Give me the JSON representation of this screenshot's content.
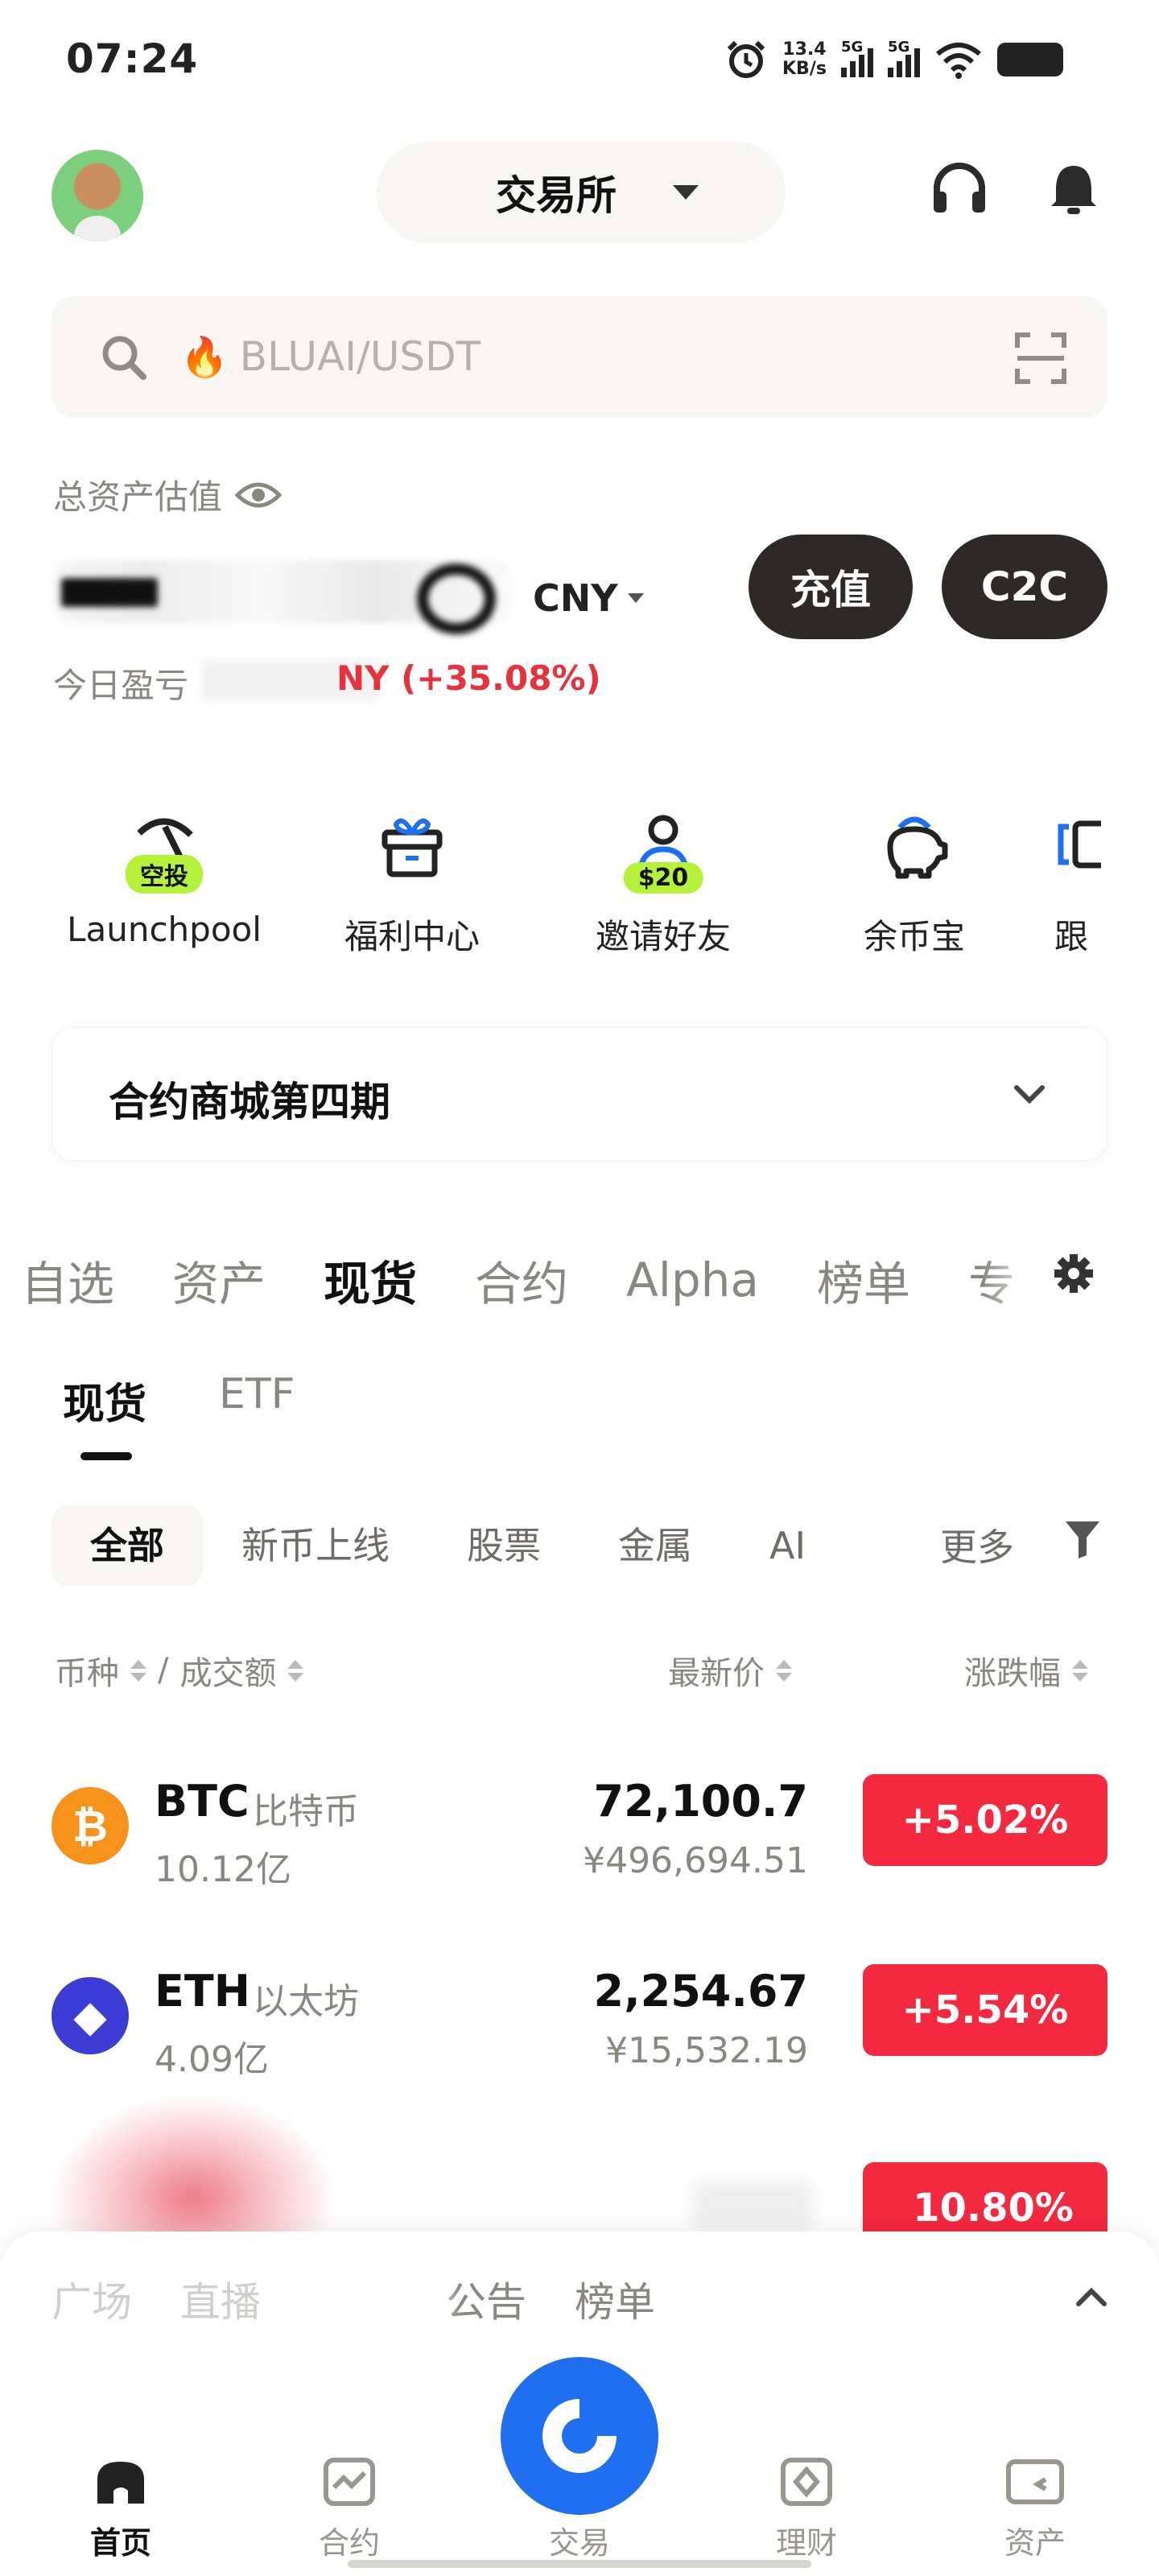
{
  "status_bar": {
    "time": "07:24",
    "speed": "13.4",
    "speed_unit": "KB/s",
    "sim1": "5G",
    "sim2": "5G"
  },
  "header": {
    "exchange_label": "交易所"
  },
  "search": {
    "placeholder": "BLUAI/USDT",
    "fire_icon": "fire-icon"
  },
  "assets": {
    "label": "总资产估值",
    "currency": "CNY",
    "deposit_label": "充值",
    "c2c_label": "C2C",
    "pnl_label": "今日盈亏",
    "pnl_visible": "NY (+35.08%)"
  },
  "quick_actions": [
    {
      "label": "Launchpool",
      "badge": "空投",
      "icon": "pickaxe-icon"
    },
    {
      "label": "福利中心",
      "icon": "gift-icon"
    },
    {
      "label": "邀请好友",
      "badge": "$20",
      "icon": "invite-user-icon"
    },
    {
      "label": "余币宝",
      "icon": "piggy-bank-icon"
    },
    {
      "label": "跟",
      "icon": "copy-trade-icon"
    }
  ],
  "promo": {
    "title": "合约商城第四期"
  },
  "market_tabs": [
    "自选",
    "资产",
    "现货",
    "合约",
    "Alpha",
    "榜单",
    "专"
  ],
  "market_active": "现货",
  "sub_tabs": [
    "现货",
    "ETF"
  ],
  "filters": [
    "全部",
    "新币上线",
    "股票",
    "金属",
    "AI"
  ],
  "filters_more": "更多",
  "columns": {
    "coin": "币种",
    "volume": "成交额",
    "price": "最新价",
    "change": "涨跌幅"
  },
  "rows": [
    {
      "symbol": "BTC",
      "name": "比特币",
      "volume": "10.12亿",
      "price": "72,100.7",
      "price_cny": "¥496,694.51",
      "change": "+5.02%",
      "icon_color": "#f7931a",
      "icon_glyph": "₿"
    },
    {
      "symbol": "ETH",
      "name": "以太坊",
      "volume": "4.09亿",
      "price": "2,254.67",
      "price_cny": "¥15,532.19",
      "change": "+5.54%",
      "icon_color": "#3c3cd6",
      "icon_glyph": "◆"
    }
  ],
  "partial_row": {
    "change": "10.80%"
  },
  "drawer_tabs": [
    "广场",
    "直播",
    "公告",
    "榜单"
  ],
  "bottom_nav": {
    "home": "首页",
    "futures": "合约",
    "trade": "交易",
    "earn": "理财",
    "assets": "资产"
  }
}
